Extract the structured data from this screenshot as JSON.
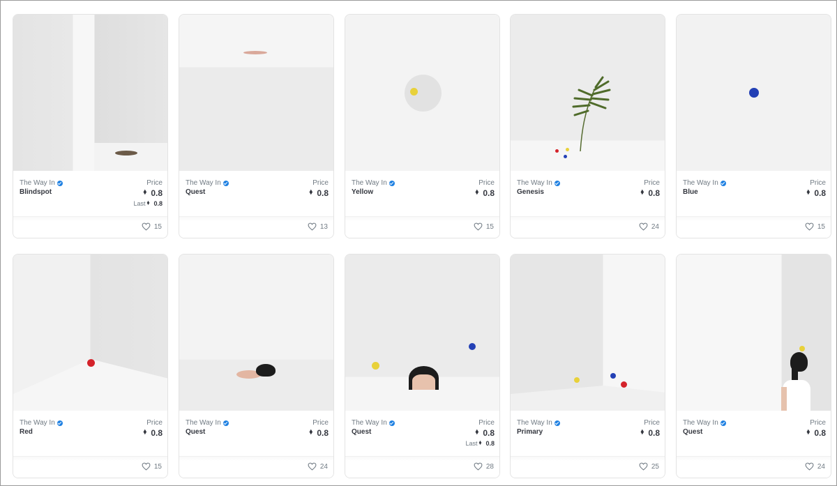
{
  "cards": [
    {
      "collection": "The Way In",
      "name": "Blindspot",
      "price_label": "Price",
      "price": "0.8",
      "last_label": "Last",
      "last": "0.8",
      "likes": "15"
    },
    {
      "collection": "The Way In",
      "name": "Quest",
      "price_label": "Price",
      "price": "0.8",
      "likes": "13"
    },
    {
      "collection": "The Way In",
      "name": "Yellow",
      "price_label": "Price",
      "price": "0.8",
      "likes": "15"
    },
    {
      "collection": "The Way In",
      "name": "Genesis",
      "price_label": "Price",
      "price": "0.8",
      "likes": "24"
    },
    {
      "collection": "The Way In",
      "name": "Blue",
      "price_label": "Price",
      "price": "0.8",
      "likes": "15"
    },
    {
      "collection": "The Way In",
      "name": "Red",
      "price_label": "Price",
      "price": "0.8",
      "likes": "15"
    },
    {
      "collection": "The Way In",
      "name": "Quest",
      "price_label": "Price",
      "price": "0.8",
      "likes": "24"
    },
    {
      "collection": "The Way In",
      "name": "Quest",
      "price_label": "Price",
      "price": "0.8",
      "last_label": "Last",
      "last": "0.8",
      "likes": "28"
    },
    {
      "collection": "The Way In",
      "name": "Primary",
      "price_label": "Price",
      "price": "0.8",
      "likes": "25"
    },
    {
      "collection": "The Way In",
      "name": "Quest",
      "price_label": "Price",
      "price": "0.8",
      "likes": "24"
    }
  ],
  "icons": {
    "verified": "verified-badge-icon",
    "currency": "ethereum-icon",
    "like": "heart-icon"
  },
  "colors": {
    "verified": "#2081e2",
    "text": "#353840",
    "muted": "#707a83",
    "yellow": "#e8d13a",
    "blue": "#2340b5",
    "red": "#d4232b"
  }
}
